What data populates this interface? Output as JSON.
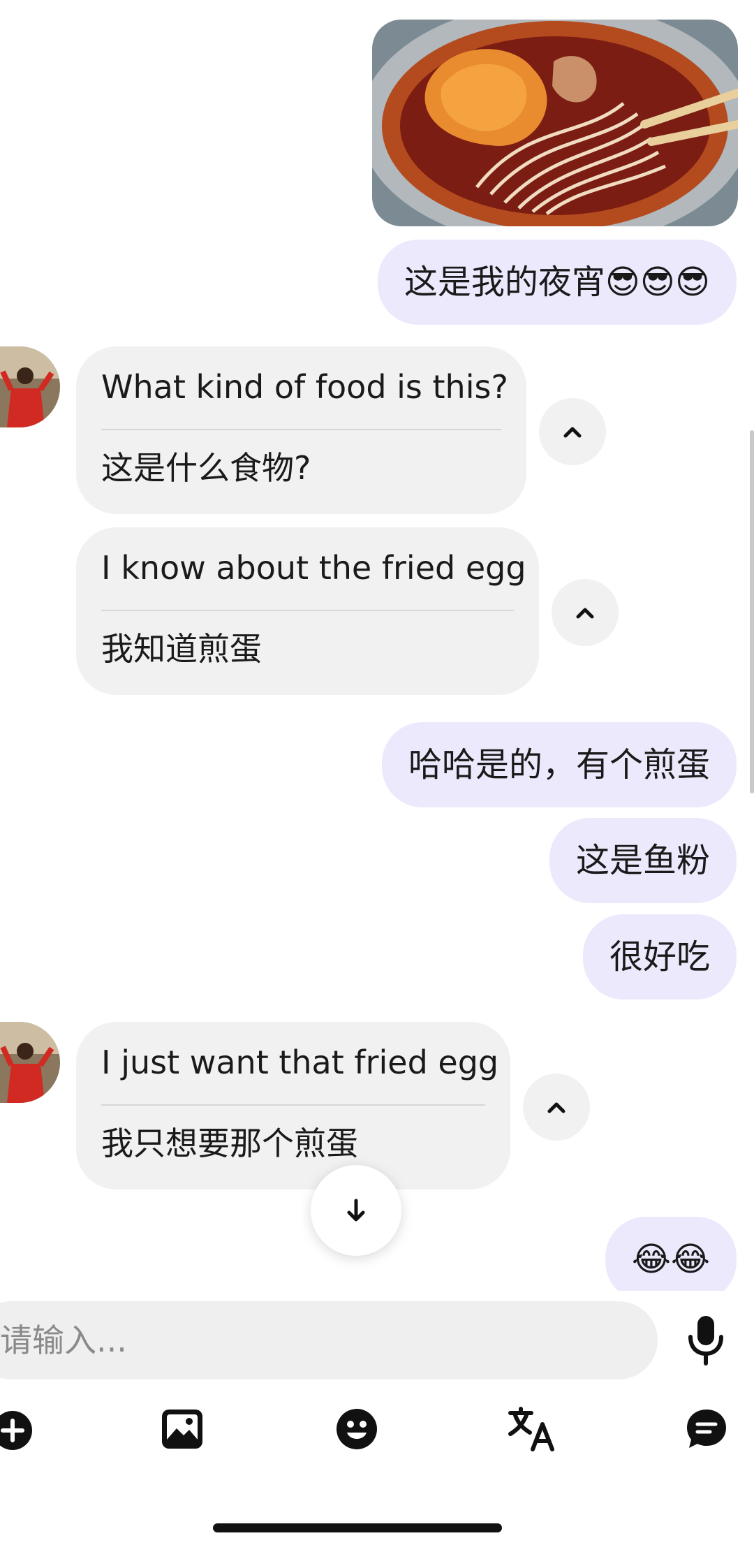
{
  "messages": {
    "m1": {
      "text": "这是我的夜宵😎😎😎"
    },
    "m2": {
      "en": "What kind of food is this?",
      "zh": "这是什么食物?"
    },
    "m3": {
      "en": "I know about the fried egg",
      "zh": "我知道煎蛋"
    },
    "m4": {
      "text": "哈哈是的，有个煎蛋"
    },
    "m5": {
      "text": "这是鱼粉"
    },
    "m6": {
      "text": "很好吃"
    },
    "m7": {
      "en": "I just want that fried egg",
      "zh": "我只想要那个煎蛋"
    },
    "m8": {
      "text": "😂😂"
    }
  },
  "composer": {
    "placeholder": "请输入..."
  },
  "colors": {
    "outgoing": "#ede9fd",
    "incoming": "#f1f1f1",
    "text": "#1a1a1a"
  },
  "icons": [
    "chevron-up-icon",
    "arrow-down-icon",
    "microphone-icon",
    "plus-circle-icon",
    "image-icon",
    "emoji-icon",
    "translate-icon",
    "chat-bubble-icon"
  ]
}
